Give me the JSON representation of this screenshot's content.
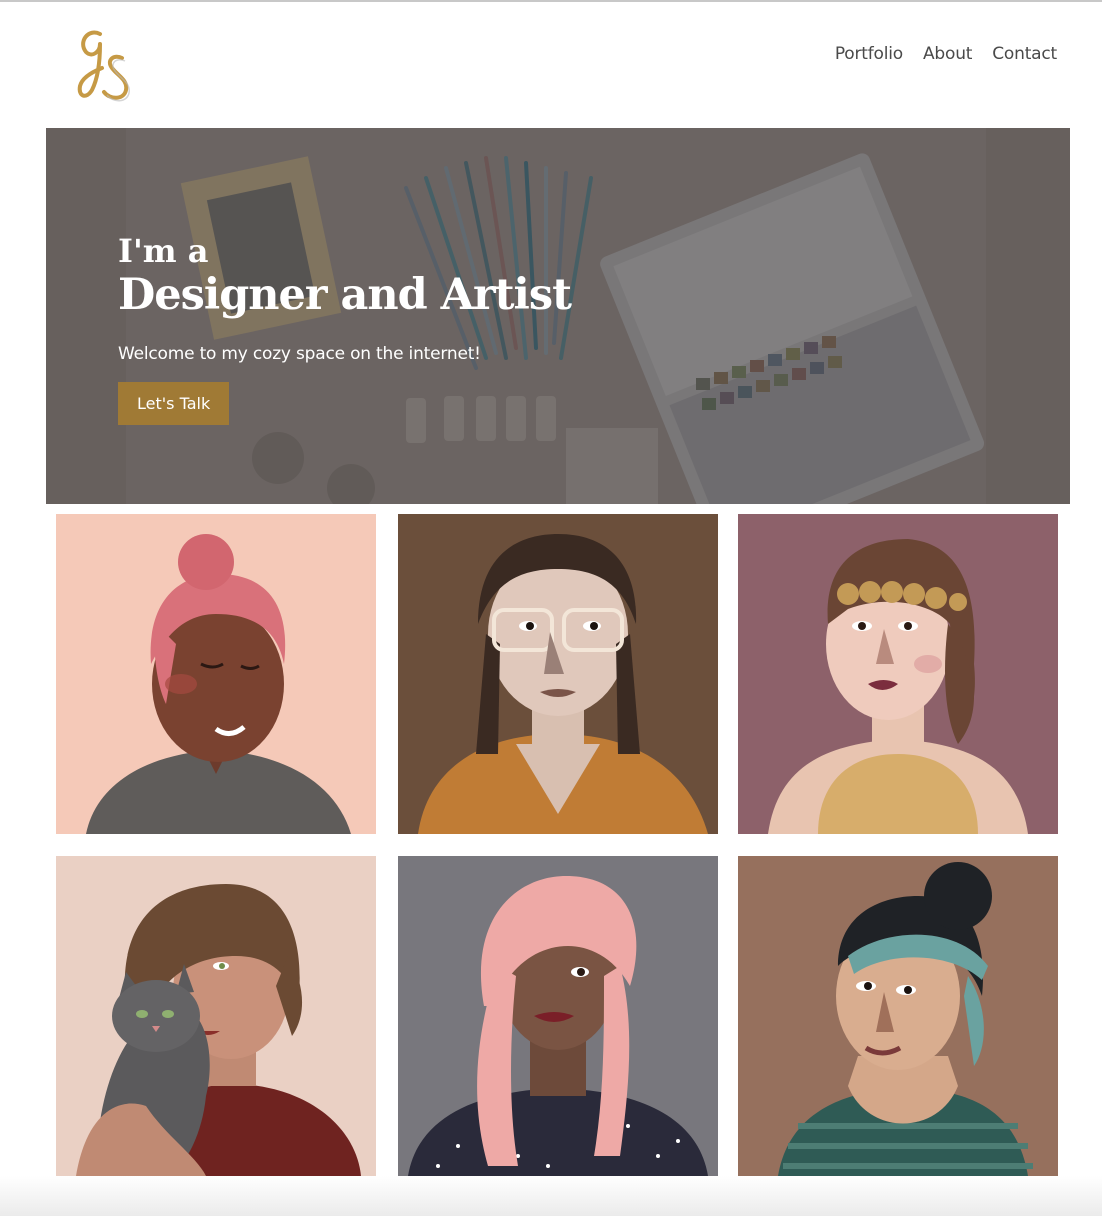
{
  "brand": {
    "logo_text": "gs",
    "accent": "#c69a45"
  },
  "nav": {
    "items": [
      "Portfolio",
      "About",
      "Contact"
    ]
  },
  "hero": {
    "kicker": "I'm a",
    "title": "Designer and Artist",
    "subtitle": "Welcome to my cozy space on the internet!",
    "cta_label": "Let's Talk",
    "cta_color": "#a07a35"
  },
  "gallery": {
    "tiles": [
      {
        "name": "pink-bun-portrait",
        "bg": "#f5c9b8"
      },
      {
        "name": "glasses-braids-portrait",
        "bg": "#6b4f3b"
      },
      {
        "name": "headband-portrait",
        "bg": "#8d616a"
      },
      {
        "name": "cat-portrait",
        "bg": "#ead0c4"
      },
      {
        "name": "pink-hair-portrait",
        "bg": "#78777d"
      },
      {
        "name": "bandana-portrait",
        "bg": "#96705d"
      }
    ]
  }
}
